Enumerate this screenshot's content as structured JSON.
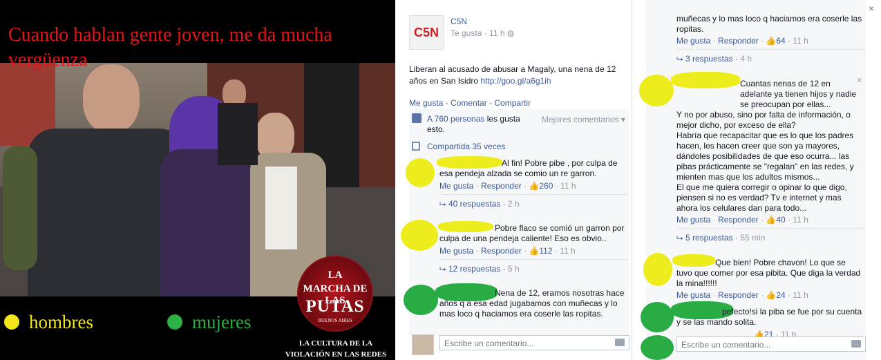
{
  "meme": {
    "headline": "Cuando hablan gente joven, me da mucha vergüenza",
    "legend": {
      "hombres": "hombres",
      "mujeres": "mujeres"
    },
    "logo": {
      "line1": "LA",
      "line2": "MARCHA DE LAS",
      "line3": "PUTAS",
      "line4": "BUENOS AIRES"
    },
    "caption": "LA CULTURA DE LA VIOLACIÓN EN LAS REDES SOCIALES",
    "colors": {
      "headline": "#e2151b",
      "hombres": "#f3e61b",
      "mujeres": "#2db046"
    }
  },
  "post": {
    "page_name": "C5N",
    "logo_text": "C5N",
    "liked": "Te gusta",
    "time": "11 h",
    "body": "Liberan al acusado de abusar a Magaly, una nena de 12 años en San Isidro",
    "url": "http://goo.gl/a6g1ih",
    "actions": {
      "like": "Me gusta",
      "comment": "Comentar",
      "share": "Compartir"
    },
    "likes_count": "A 760 personas",
    "likes_suffix": "les gusta esto.",
    "best_comments": "Mejores comentarios",
    "shares": "Compartida 35 veces",
    "comment_placeholder": "Escribe un comentario..."
  },
  "comments_mid": [
    {
      "name": "Al fin!",
      "text": "Pobre pibe , por culpa de esa pendeja alzada se comio un re garron.",
      "like": "Me gusta",
      "reply": "Responder",
      "likes": "260",
      "time": "11 h",
      "replies": "40 respuestas",
      "replies_time": "2 h"
    },
    {
      "name": "",
      "text": "Pobre flaco se comió un garron por culpa de una pendeja caliente! Eso es obvio..",
      "like": "Me gusta",
      "reply": "Responder",
      "likes": "112",
      "time": "11 h",
      "replies": "12 respuestas",
      "replies_time": "5 h"
    },
    {
      "name": "",
      "text": "Nena de 12, eramos nosotras hace años q a esa edad jugabamos con muñecas y lo mas loco q haciamos era coserle las ropitas."
    }
  ],
  "comments_right": [
    {
      "text": "muñecas y lo mas loco q haciamos era coserle las ropitas.",
      "like": "Me gusta",
      "reply": "Responder",
      "likes": "64",
      "time": "11 h",
      "replies": "3 respuestas",
      "replies_time": "4 h"
    },
    {
      "text": "Cuantas nenas de 12 en adelante ya tienen hijos y nadie se preocupan por ellas...",
      "text2": "Y no por abuso, sino por falta de información, o mejor dicho, por exceso de ella?",
      "text3": "Habría que recapacitar que es lo que los padres hacen, les hacen creer que son ya mayores, dándoles posibilidades de que eso ocurra... las pibas prácticamente se \"regalan\" en las redes, y mienten mas que los adultos mismos...",
      "text4": "El que me quiera corregir o opinar lo que digo, piensen si no es verdad? Tv e internet y mas ahora los celulares dan para todo...",
      "like": "Me gusta",
      "reply": "Responder",
      "likes": "40",
      "time": "11 h",
      "replies": "5 respuestas",
      "replies_time": "55 min"
    },
    {
      "text": "Que bien! Pobre chavon! Lo que se tuvo que comer por esa pibita. Que diga la verdad la mina!!!!!!",
      "like": "Me gusta",
      "reply": "Responder",
      "likes": "24",
      "time": "11 h"
    },
    {
      "text": "pefecto!si la piba se fue por su cuenta y se las mando solita.",
      "likes": "21",
      "time": "11 h"
    }
  ],
  "right_input_placeholder": "Escribe un comentario...",
  "close_symbol": "×",
  "small_close": "✕"
}
